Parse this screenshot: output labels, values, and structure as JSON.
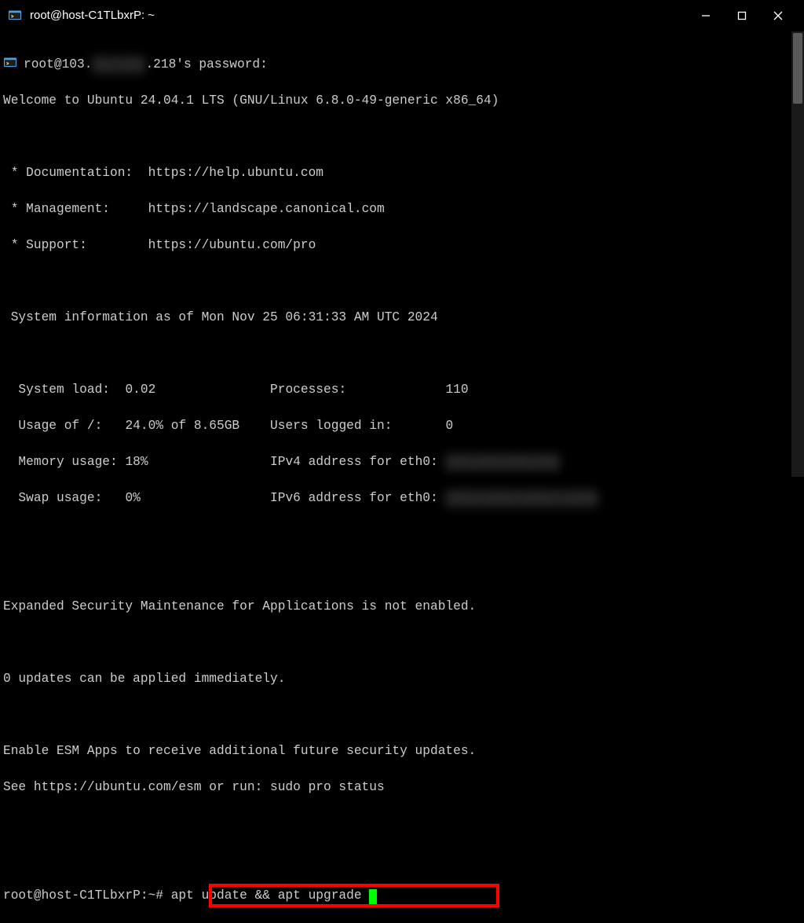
{
  "titlebar": {
    "title": "root@host-C1TLbxrP: ~"
  },
  "prompt_line": {
    "ip_prefix": "root@103.",
    "ip_hidden": "xxx.xxx",
    "ip_suffix": ".218's password:"
  },
  "welcome": "Welcome to Ubuntu 24.04.1 LTS (GNU/Linux 6.8.0-49-generic x86_64)",
  "links": {
    "doc_label": " * Documentation:  ",
    "doc_url": "https://help.ubuntu.com",
    "mgmt_label": " * Management:     ",
    "mgmt_url": "https://landscape.canonical.com",
    "support_label": " * Support:        ",
    "support_url": "https://ubuntu.com/pro"
  },
  "sysinfo_header": " System information as of Mon Nov 25 06:31:33 AM UTC 2024",
  "sysinfo": {
    "load_label": "  System load:  ",
    "load_val": "0.02",
    "proc_label": "Processes:             ",
    "proc_val": "110",
    "disk_label": "  Usage of /:   ",
    "disk_val": "24.0% of 8.65GB",
    "users_label": "Users logged in:       ",
    "users_val": "0",
    "mem_label": "  Memory usage: ",
    "mem_val": "18%",
    "ipv4_label": "IPv4 address for eth0: ",
    "ipv4_hidden": "xxx.xxx.xxx.xxx",
    "swap_label": "  Swap usage:   ",
    "swap_val": "0%",
    "ipv6_label": "IPv6 address for eth0: ",
    "ipv6_hidden": "xxxx:xxxx:xxxx::xxxx"
  },
  "esm1": "Expanded Security Maintenance for Applications is not enabled.",
  "updates": "0 updates can be applied immediately.",
  "esm2": "Enable ESM Apps to receive additional future security updates.",
  "esm3": "See https://ubuntu.com/esm or run: sudo pro status",
  "shell_prompt": "root@host-C1TLbxrP:~# ",
  "typed_command": "apt update && apt upgrade "
}
